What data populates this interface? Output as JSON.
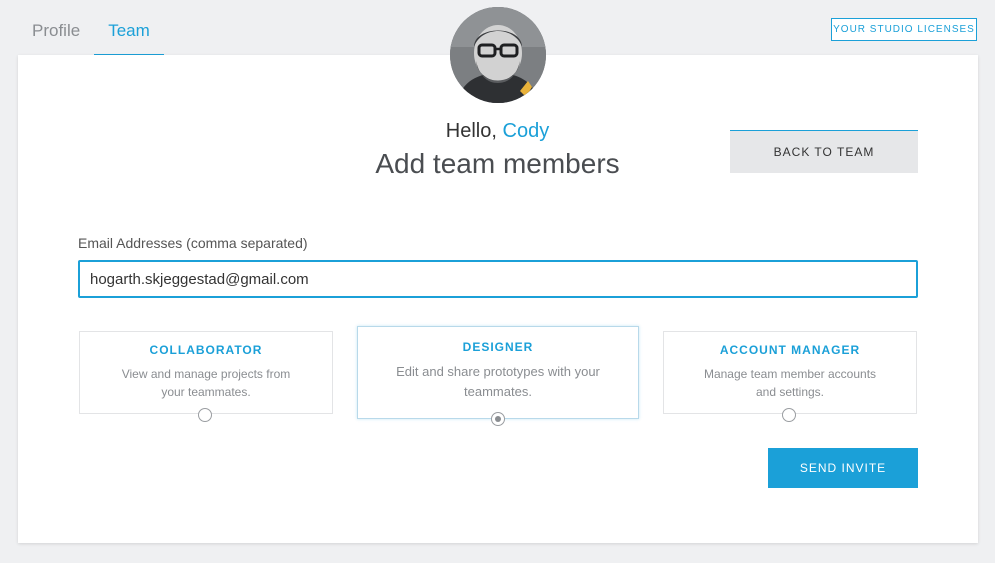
{
  "tabs": [
    {
      "label": "Profile",
      "active": false
    },
    {
      "label": "Team",
      "active": true
    }
  ],
  "header": {
    "licenses_label": "YOUR STUDIO LICENSES"
  },
  "greeting": {
    "hello": "Hello,",
    "name": "Cody",
    "title": "Add team members"
  },
  "back_button": "BACK TO TEAM",
  "email": {
    "label": "Email Addresses (comma separated)",
    "value": "hogarth.skjeggestad@gmail.com"
  },
  "roles": [
    {
      "title": "COLLABORATOR",
      "description": "View and manage projects from your teammates.",
      "selected": false
    },
    {
      "title": "DESIGNER",
      "description": "Edit and share prototypes with your teammates.",
      "selected": true
    },
    {
      "title": "ACCOUNT MANAGER",
      "description": "Manage team member accounts and settings.",
      "selected": false
    }
  ],
  "send_button": "SEND INVITE",
  "colors": {
    "accent": "#1ba0d8",
    "background": "#eff0f2",
    "card": "#ffffff",
    "button_secondary": "#e6e7e9"
  }
}
